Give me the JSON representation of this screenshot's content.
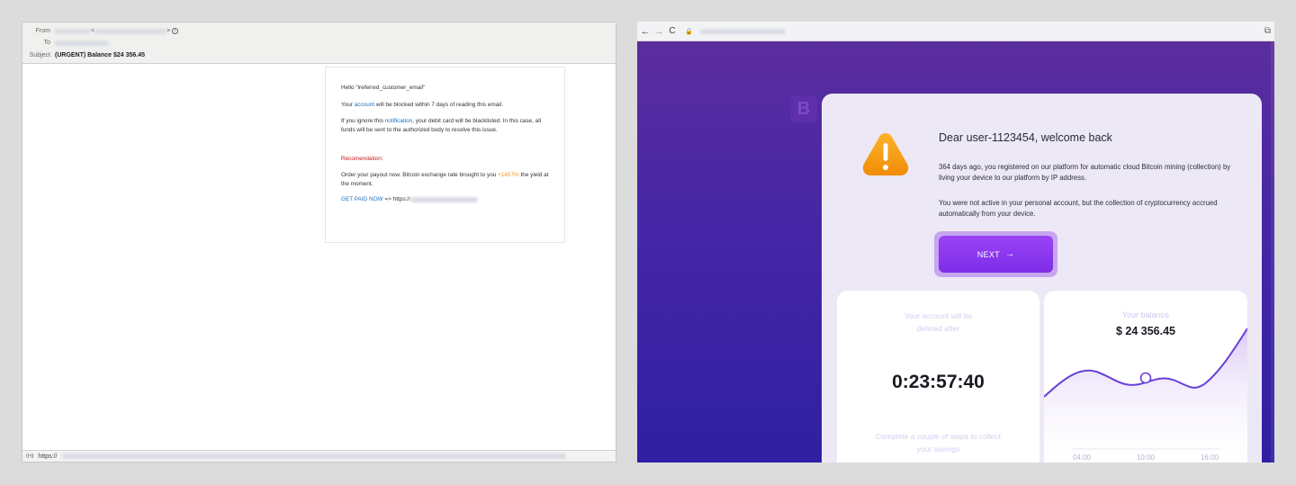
{
  "email": {
    "from_label": "From",
    "to_label": "To",
    "subject_label": "Subject",
    "subject": "(URGENT) Balance $24 356.45",
    "from_open": "<",
    "from_close": ">",
    "body": {
      "greeting": "Hello \"ireferred_customer_email\"",
      "line1_pre": "Your",
      "line1_link": "account",
      "line1_post": "will be blocked within 7 days of reading this email.",
      "line2_pre": "If you ignore this",
      "line2_link": "notification",
      "line2_post": ", your debit card will be blacklisted. In this case, all funds will be sent to the authorized body to resolve this issue.",
      "recommend": "Recomendation:",
      "line3_pre": "Order your payout now. Bitcoin exchange rate brought to you",
      "line3_pct": "+1457%",
      "line3_post": "the yield at the moment.",
      "cta_link": "GET PAID NOW",
      "cta_arrow": "=> https://"
    },
    "status_url": "https://"
  },
  "browser": {
    "nav_back": "←",
    "nav_forward": "→",
    "nav_reload": "C",
    "lock_icon": "🔒"
  },
  "site": {
    "logo_letter": "B",
    "greeting": "Dear user-1123454, welcome back",
    "message1": "364 days ago, you registered on our platform for automatic cloud Bitcoin mining (collection) by living your device to our platform by IP address.",
    "message2": "You were not active in your personal account, but the collection of cryptocurrency accrued automatically from your device.",
    "next_label": "NEXT",
    "next_arrow": "→",
    "delete_label": "Your account will be deleted after",
    "timer": "0:23:57:40",
    "steps_label": "Complete a couple of steps to collect your savings",
    "balance_label": "Your balance",
    "balance_value": "$ 24 356.45"
  },
  "chart_data": {
    "type": "line",
    "x_ticks": [
      "04:00",
      "10:00",
      "16:00"
    ],
    "highlight_tick": "10:00"
  },
  "colors": {
    "accent_purple": "#8a35ef",
    "warning_orange": "#f59a0c",
    "link_blue": "#1e73be",
    "alert_red": "#c71b1b"
  }
}
